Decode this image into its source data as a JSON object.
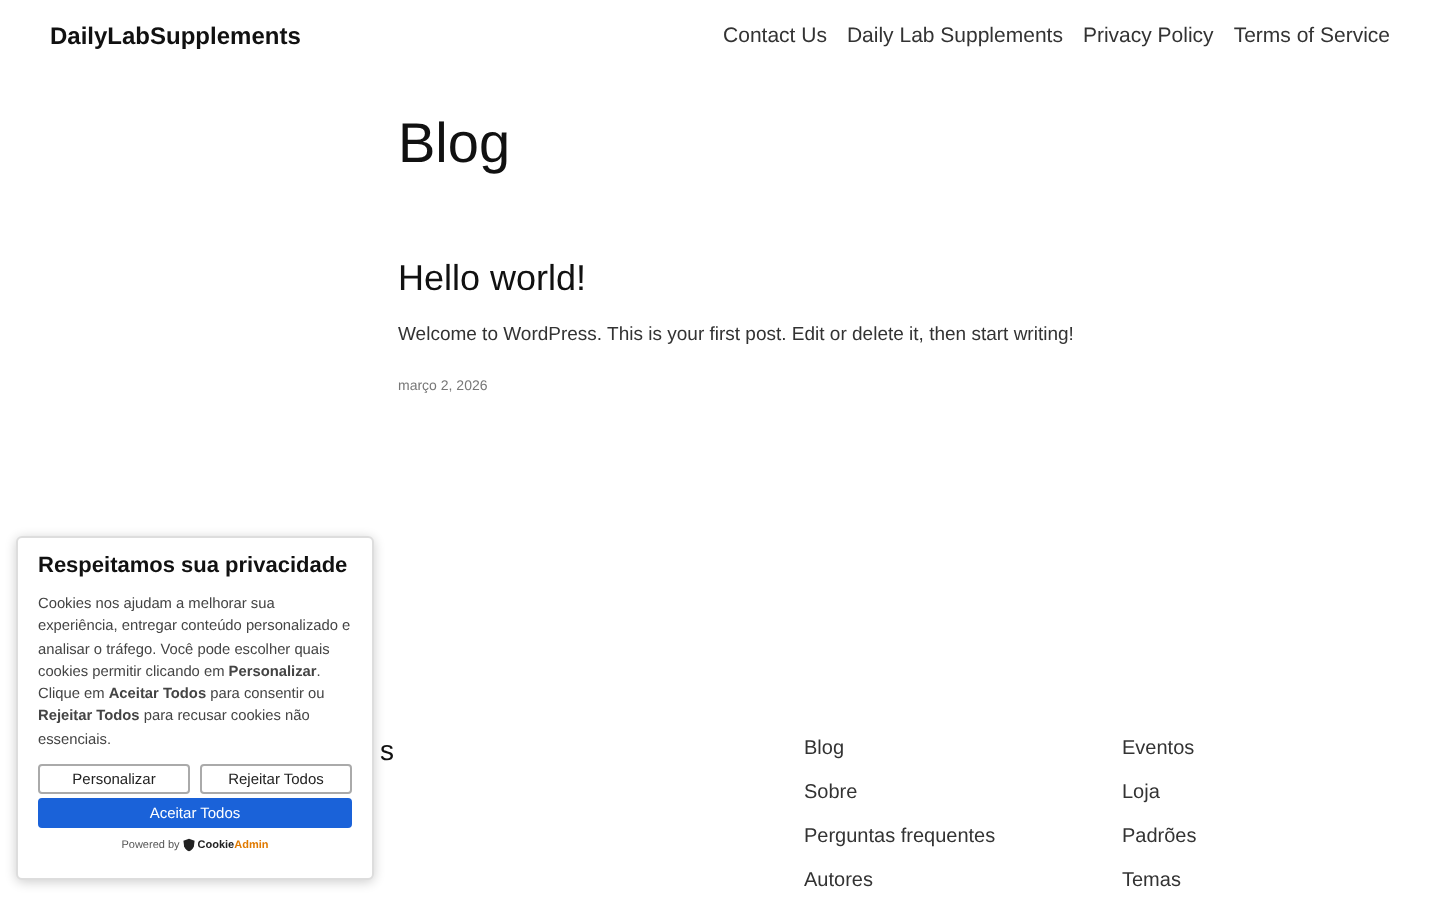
{
  "header": {
    "site_title": "DailyLabSupplements",
    "nav": [
      "Contact Us",
      "Daily Lab Supplements",
      "Privacy Policy",
      "Terms of Service"
    ]
  },
  "main": {
    "heading": "Blog",
    "post": {
      "title": "Hello world!",
      "excerpt": "Welcome to WordPress. This is your first post. Edit or delete it, then start writing!",
      "date": "março 2, 2026"
    }
  },
  "footer": {
    "site_title": "s",
    "columns": [
      [
        "Blog",
        "Sobre",
        "Perguntas frequentes",
        "Autores"
      ],
      [
        "Eventos",
        "Loja",
        "Padrões",
        "Temas"
      ]
    ]
  },
  "cookie_banner": {
    "title": "Respeitamos sua privacidade",
    "body": "Cookies nos ajudam a melhorar sua experiência, entregar conteúdo personalizado e analisar o tráfego. Você pode escolher quais cookies permitir clicando em **Personalizar**. Clique em **Aceitar Todos** para consentir ou **Rejeitar Todos** para recusar cookies não essenciais.",
    "buttons": [
      {
        "label": "Personalizar",
        "kind": "outline"
      },
      {
        "label": "Rejeitar Todos",
        "kind": "outline"
      },
      {
        "label": "Aceitar Todos",
        "kind": "primary"
      }
    ],
    "powered_by": "Powered by",
    "brand": [
      "Cookie",
      "Admin"
    ]
  }
}
